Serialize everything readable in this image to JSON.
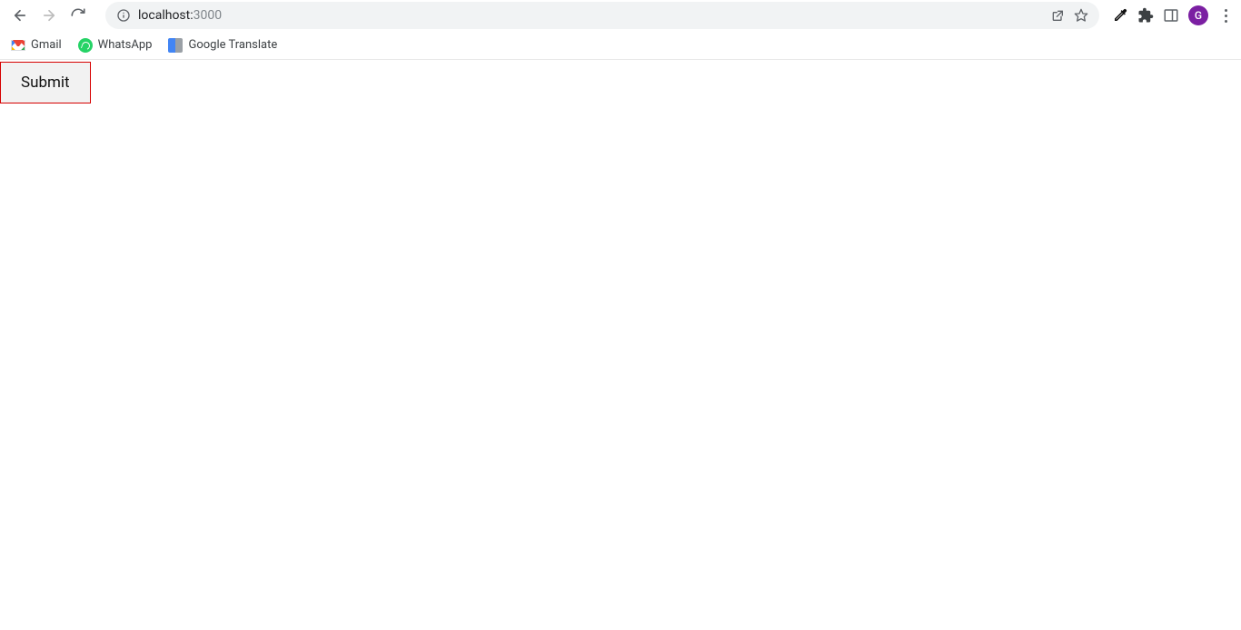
{
  "browser": {
    "url_host": "localhost:",
    "url_port": "3000",
    "avatar_letter": "G"
  },
  "bookmarks": [
    {
      "label": "Gmail"
    },
    {
      "label": "WhatsApp"
    },
    {
      "label": "Google Translate"
    }
  ],
  "page": {
    "submit_label": "Submit"
  }
}
